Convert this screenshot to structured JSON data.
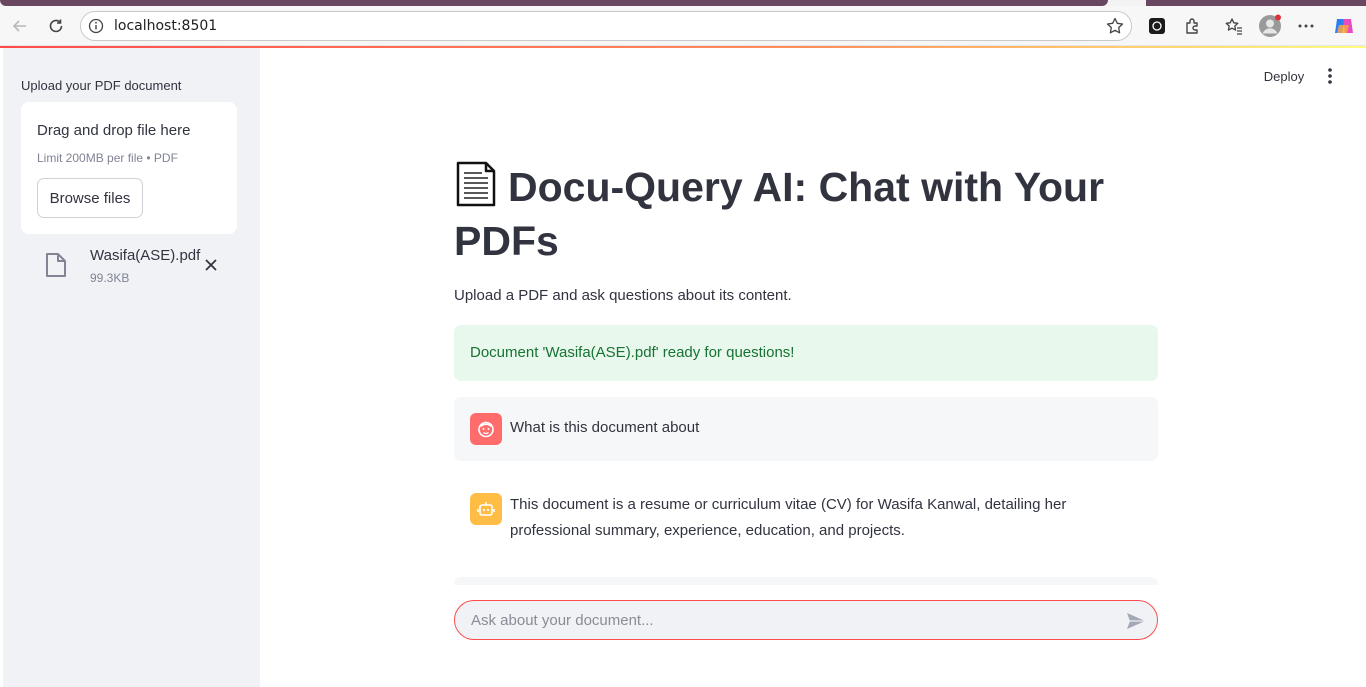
{
  "browser": {
    "url": "localhost:8501",
    "accent_color": "#ff4b4b"
  },
  "sidebar": {
    "uploader_label": "Upload your PDF document",
    "dropzone_title": "Drag and drop file here",
    "dropzone_limit": "Limit 200MB per file • PDF",
    "browse_label": "Browse files",
    "file": {
      "name": "Wasifa(ASE).pdf",
      "size": "99.3KB"
    }
  },
  "header": {
    "deploy_label": "Deploy"
  },
  "main": {
    "title": "Docu-Query AI: Chat with Your PDFs",
    "subtitle": "Upload a PDF and ask questions about its content.",
    "success_message": "Document 'Wasifa(ASE).pdf' ready for questions!",
    "messages": [
      {
        "role": "user",
        "text": "What is this document about"
      },
      {
        "role": "assistant",
        "text": "This document is a resume or curriculum vitae (CV) for Wasifa Kanwal, detailing her professional summary, experience, education, and projects."
      }
    ],
    "chat_input_placeholder": "Ask about your document..."
  }
}
